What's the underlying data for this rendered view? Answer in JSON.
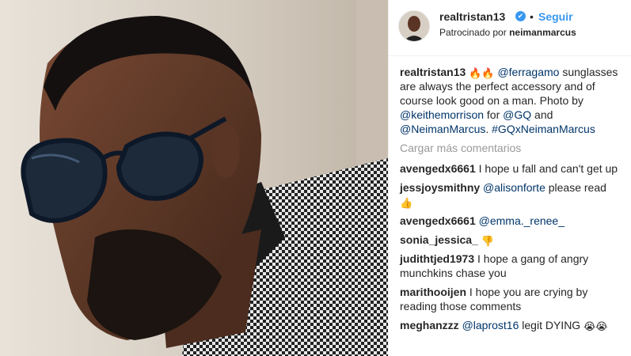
{
  "post": {
    "username": "realtristan13",
    "verified_mark": "✔",
    "separator": "•",
    "follow_label": "Seguir",
    "sponsored_prefix": "Patrocinado por",
    "sponsor": "neimanmarcus"
  },
  "caption": {
    "user": "realtristan13",
    "emojis": "🔥🔥",
    "mention1": "@ferragamo",
    "text1": " sunglasses are always the perfect accessory and of course look good on a man. Photo by ",
    "mention2": "@keithemorrison",
    "text2": " for ",
    "mention3": "@GQ",
    "text3": " and ",
    "mention4": "@NeimanMarcus",
    "text4": ". ",
    "hashtag": "#GQxNeimanMarcus"
  },
  "load_more_label": "Cargar más comentarios",
  "comments": [
    {
      "user": "avengedx6661",
      "text": "I hope u fall and can't get up"
    },
    {
      "user": "jessjoysmithny",
      "mention": "@alisonforte",
      "text": " please read",
      "emoji": "👍"
    },
    {
      "user": "avengedx6661",
      "mention": "@emma._renee_"
    },
    {
      "user": "sonia_jessica_",
      "emoji": "👎"
    },
    {
      "user": "judithtjed1973",
      "text": "I hope a gang of angry munchkins chase you"
    },
    {
      "user": "marithooijen",
      "text": "I hope you are crying by reading those comments"
    },
    {
      "user": "meghanzzz",
      "mention": "@laprost16",
      "text": " legit DYING ",
      "emoji": "😭😭"
    }
  ],
  "icons": {
    "verified": "verified-badge-icon",
    "fire": "fire-emoji-icon",
    "thumbs_up": "thumbs-up-emoji-icon",
    "thumbs_down": "thumbs-down-emoji-icon",
    "crying": "crying-laughing-emoji-icon"
  },
  "colors": {
    "link": "#003569",
    "follow": "#3897f0",
    "muted": "#999999"
  }
}
